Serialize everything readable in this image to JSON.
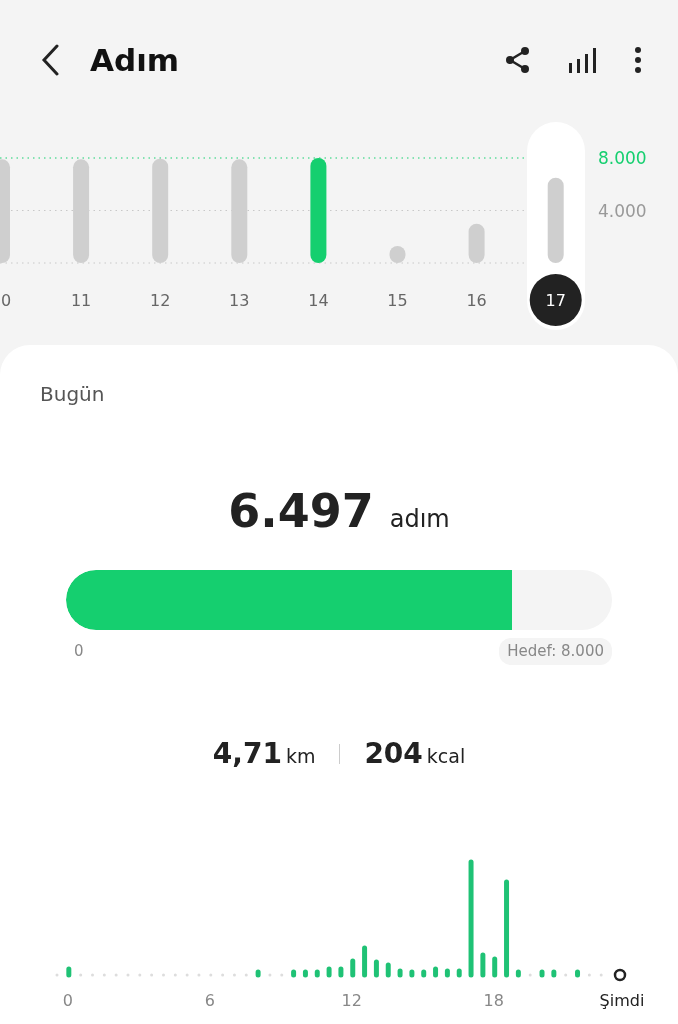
{
  "header": {
    "title": "Adım"
  },
  "week_chart": {
    "days": [
      {
        "selected": false,
        "color": "#cfcfcf"
      },
      {
        "selected": false,
        "color": "#cfcfcf"
      },
      {
        "selected": false,
        "color": "#cfcfcf"
      },
      {
        "selected": false,
        "color": "#cfcfcf"
      },
      {
        "selected": false,
        "color": "#15cf6f"
      },
      {
        "selected": false,
        "color": "#cfcfcf"
      },
      {
        "selected": false,
        "color": "#cfcfcf"
      },
      {
        "selected": true,
        "color": "#cfcfcf"
      }
    ],
    "chart_data": {
      "type": "bar",
      "categories": [
        "0",
        "11",
        "12",
        "13",
        "14",
        "15",
        "16",
        "17"
      ],
      "values": [
        7900,
        7900,
        7950,
        7900,
        8000,
        1300,
        3000,
        6500
      ],
      "ylim": [
        0,
        8000
      ],
      "yticks": [
        {
          "value": 4000,
          "label": "4.000"
        },
        {
          "value": 8000,
          "label": "8.000"
        }
      ]
    }
  },
  "today": {
    "label": "Bugün",
    "steps": "6.497",
    "steps_unit": "adım",
    "progress": {
      "level": 0.816,
      "start": "0",
      "goal": "Hedef: 8.000"
    },
    "distance": "4,71",
    "distance_unit": "km",
    "energy": "204",
    "energy_unit": "kcal"
  },
  "hourly": {
    "axis_labels": [
      "0",
      "6",
      "12",
      "18"
    ],
    "now_label": "Şimdi"
  }
}
